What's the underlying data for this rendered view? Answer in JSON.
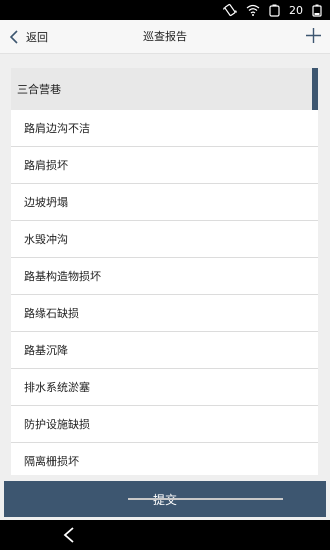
{
  "status_bar": {
    "battery": "20",
    "icons": [
      "vibrate-icon",
      "wifi-icon",
      "battery-icon"
    ]
  },
  "nav": {
    "back_label": "返回",
    "title": "巡查报告",
    "add_icon": "plus-icon"
  },
  "list": {
    "group_header": "三合营巷",
    "items": [
      "路肩边沟不洁",
      "路肩损坏",
      "边坡坍塌",
      "水毁冲沟",
      "路基构造物损坏",
      "路缘石缺损",
      "路基沉降",
      "排水系统淤塞",
      "防护设施缺损",
      "隔离栅损坏"
    ]
  },
  "submit_label": "提交",
  "colors": {
    "accent": "#3d5670",
    "background": "#efefef",
    "nav_bg": "#f7f7f7",
    "header_bg": "#e8e8e8"
  }
}
